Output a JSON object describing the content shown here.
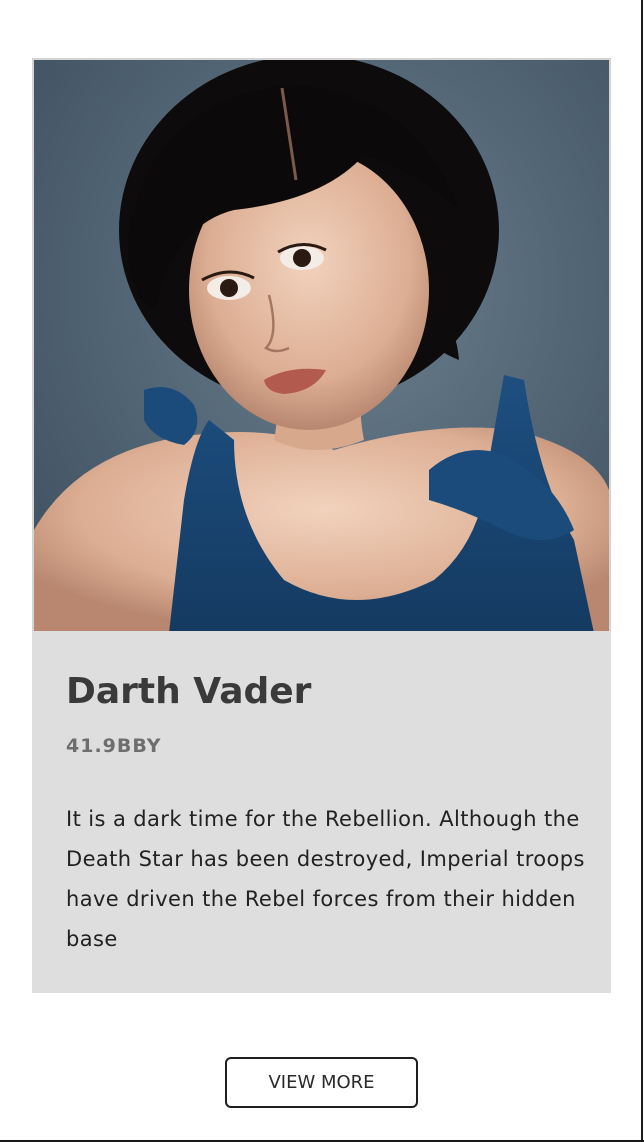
{
  "card": {
    "image": {
      "description_icon": "portrait-photo"
    },
    "title": "Darth Vader",
    "subtitle": "41.9BBY",
    "text": "It is a dark time for the Rebellion. Although the Death Star has been destroyed, Imperial troops have driven the Rebel forces from their hidden base"
  },
  "actions": {
    "view_more_label": "VIEW MORE"
  },
  "colors": {
    "card_background": "#dedede",
    "title": "#3a3a3a",
    "subtitle": "#6e6e6e",
    "body_text": "#222222",
    "button_border": "#1f1f1f"
  }
}
